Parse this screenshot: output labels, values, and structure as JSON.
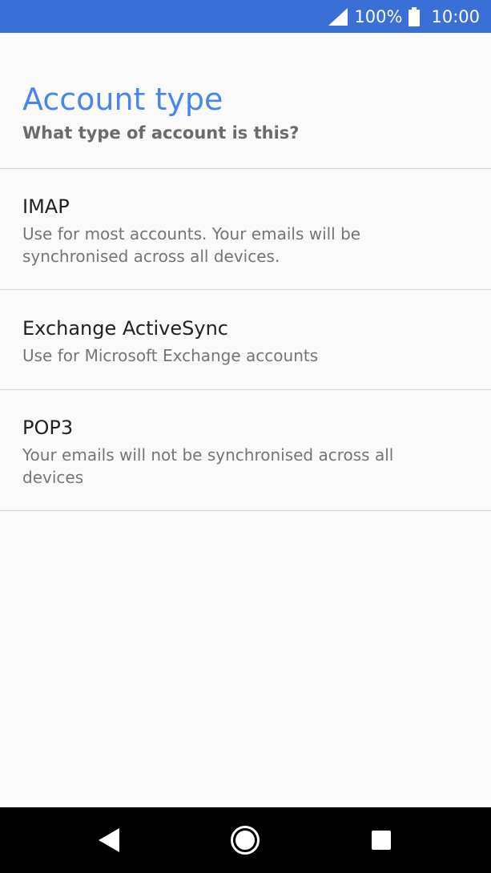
{
  "status_bar": {
    "battery_percent": "100%",
    "time": "10:00",
    "icons": [
      "signal-icon",
      "battery-icon"
    ]
  },
  "header": {
    "title": "Account type",
    "subtitle": "What type of account is this?"
  },
  "options": [
    {
      "title": "IMAP",
      "description": "Use for most accounts. Your emails will be synchronised across all devices."
    },
    {
      "title": "Exchange ActiveSync",
      "description": "Use for Microsoft Exchange accounts"
    },
    {
      "title": "POP3",
      "description": "Your emails will not be synchronised across all devices"
    }
  ],
  "nav_bar": {
    "icons": [
      "back-icon",
      "home-icon",
      "recents-icon"
    ]
  },
  "colors": {
    "status_bar": "#3a6fd8",
    "accent": "#4a86e8",
    "background": "#fafafa",
    "nav_bar": "#000000"
  }
}
